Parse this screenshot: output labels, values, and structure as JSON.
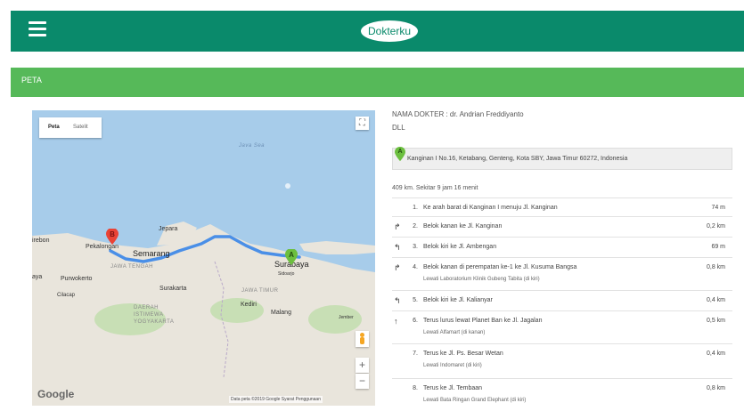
{
  "header": {
    "brand": "Dokterku"
  },
  "section": {
    "title": "PETA"
  },
  "map": {
    "type_buttons": [
      "Peta",
      "Satelit"
    ],
    "labels": {
      "java_sea": "Java Sea",
      "cirebon": "irebon",
      "pekalongan": "Pekalongan",
      "jepara": "Jepara",
      "semarang": "Semarang",
      "jawa_tengah": "JAWA TENGAH",
      "aya": "aya",
      "purwokerto": "Purwokerto",
      "cilacap": "Cilacap",
      "surakarta": "Surakarta",
      "daerah_istimewa": "DAERAH ISTIMEWA YOGYAKARTA",
      "jawa_timur": "JAWA TIMUR",
      "kediri": "Kediri",
      "malang": "Malang",
      "surabaya": "Surabaya",
      "sidoarjo": "Sidoarjo",
      "jember": "Jember"
    },
    "marker_a": "A",
    "marker_b": "B",
    "zoom_in": "+",
    "zoom_out": "−",
    "google": "Google",
    "attribution": "Data peta ©2019 Google   Syarat Penggunaan"
  },
  "directions": {
    "doctor": "NAMA DOKTER : dr. Andrian Freddiyanto",
    "dll": "DLL",
    "start_marker": "A",
    "address": "Kanginan I No.16, Ketabang, Genteng, Kota SBY, Jawa Timur 60272, Indonesia",
    "summary": "409 km. Sekitar 9 jam 16 menit",
    "steps": [
      {
        "turn": "",
        "num": "1.",
        "text": "Ke arah barat di Kanginan I menuju Jl. Kanginan",
        "note": "",
        "dist": "74 m"
      },
      {
        "turn": "↱",
        "num": "2.",
        "text": "Belok kanan ke Jl. Kanginan",
        "note": "",
        "dist": "0,2 km"
      },
      {
        "turn": "↰",
        "num": "3.",
        "text": "Belok kiri ke Jl. Ambengan",
        "note": "",
        "dist": "69 m"
      },
      {
        "turn": "↱",
        "num": "4.",
        "text": "Belok kanan di perempatan ke-1 ke Jl. Kusuma Bangsa",
        "note": "Lewati Laboratorium Klinik Gubeng Tabita (di kiri)",
        "dist": "0,8 km"
      },
      {
        "turn": "↰",
        "num": "5.",
        "text": "Belok kiri ke Jl. Kalianyar",
        "note": "",
        "dist": "0,4 km"
      },
      {
        "turn": "↑",
        "num": "6.",
        "text": "Terus lurus lewat Planet Ban ke Jl. Jagalan",
        "note": "Lewati Alfamart (di kanan)",
        "dist": "0,5 km"
      },
      {
        "turn": "",
        "num": "7.",
        "text": "Terus ke Jl. Ps. Besar Wetan",
        "note": "Lewati Indomaret (di kiri)",
        "dist": "0,4 km"
      },
      {
        "turn": "",
        "num": "8.",
        "text": "Terus ke Jl. Tembaan",
        "note": "Lewati Bata Ringan Grand Elephant (di kiri)",
        "dist": "0,8 km"
      }
    ]
  },
  "colors": {
    "header": "#0a8a6b",
    "section": "#56b959",
    "route": "#4a8fe7"
  }
}
